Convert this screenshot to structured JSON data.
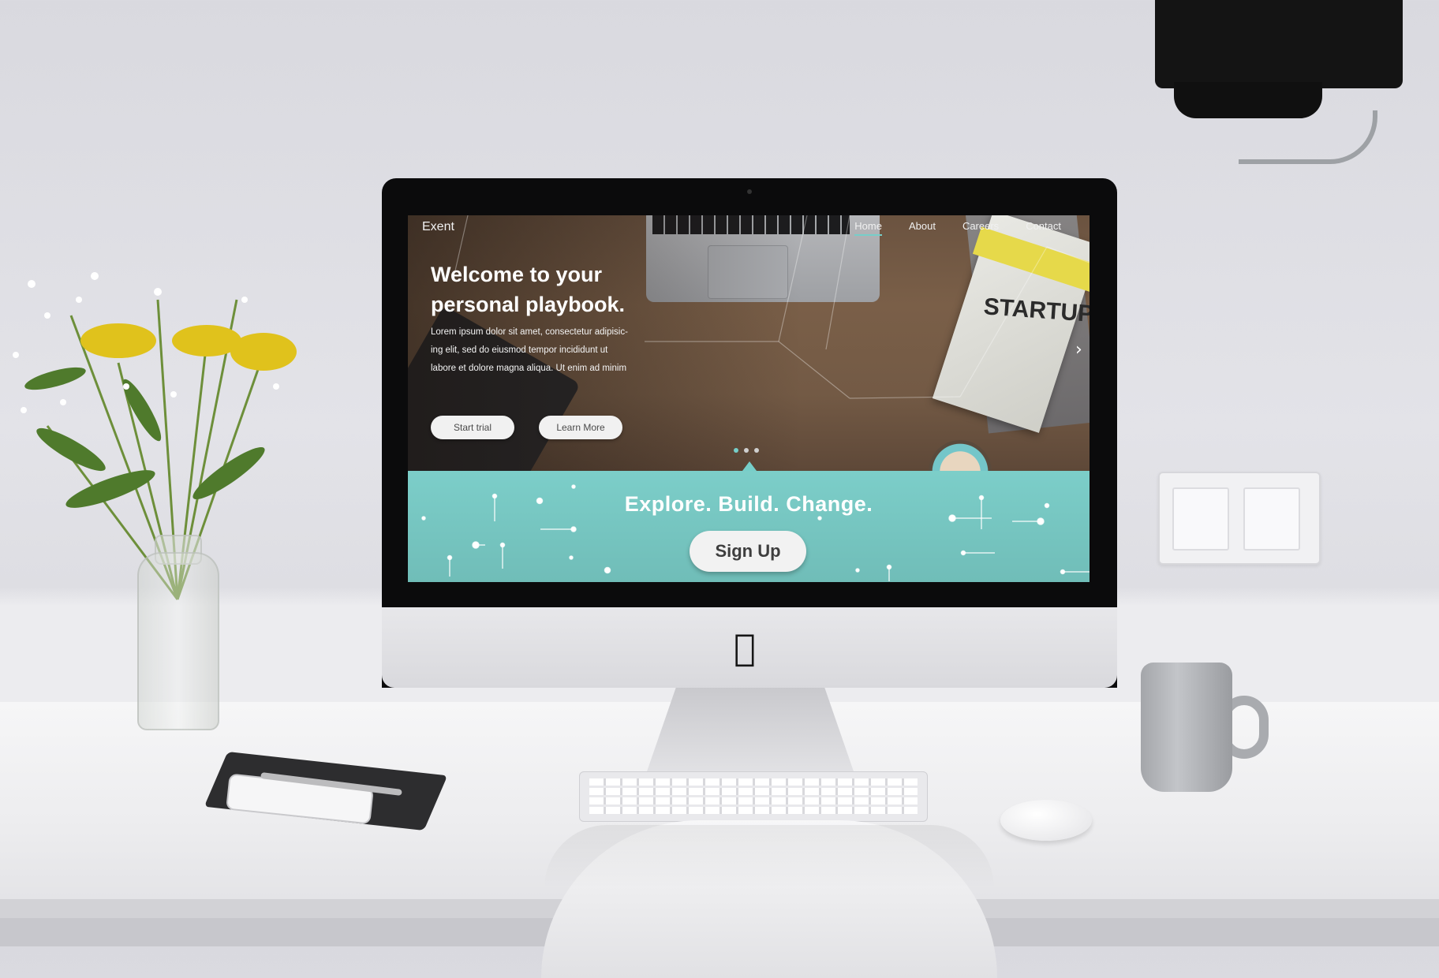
{
  "site": {
    "logo": "Exent",
    "nav": [
      "Home",
      "About",
      "Careers",
      "Contact"
    ],
    "active_nav": "Home",
    "hero_title_line1": "Welcome to your",
    "hero_title_line2": "personal playbook.",
    "hero_body_line1": "Lorem ipsum dolor sit amet, consectetur adipisic-",
    "hero_body_line2": "ing elit, sed do eiusmod tempor incididunt ut",
    "hero_body_line3": "labore et dolore magna aliqua. Ut enim ad minim",
    "btn_trial": "Start trial",
    "btn_learn": "Learn More",
    "carousel_dots": 3,
    "active_dot": 0,
    "cta_title": "Explore. Build. Change.",
    "cta_button": "Sign Up",
    "accent": "#76cec9"
  },
  "scene": {
    "book_title": "STARTUP",
    "apple_logo": "apple-logo-icon"
  }
}
